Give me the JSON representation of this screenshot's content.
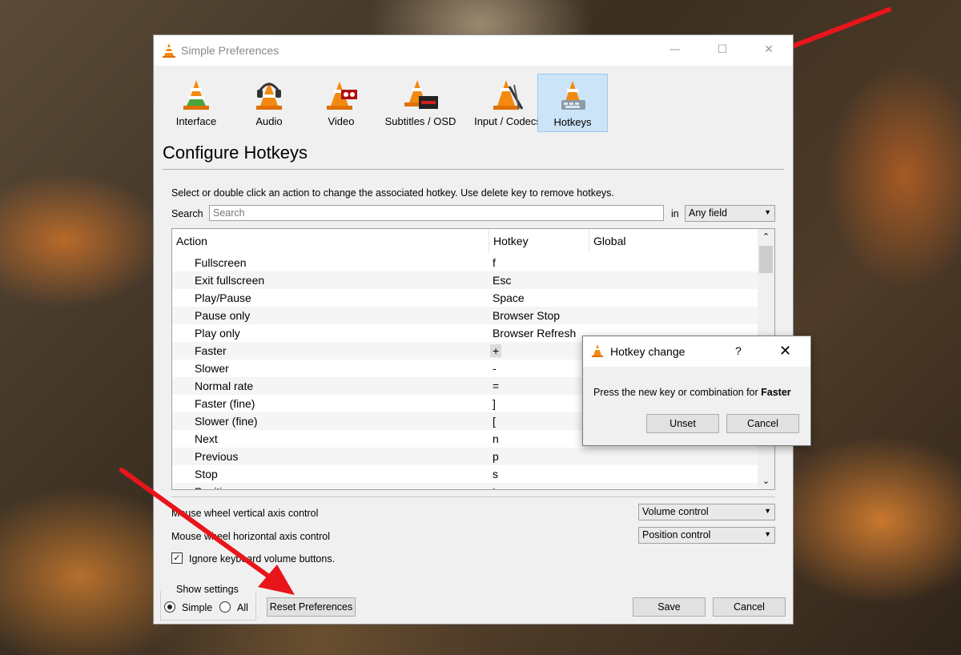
{
  "window": {
    "title": "Simple Preferences",
    "controls": {
      "minimize": "—",
      "maximize": "☐",
      "close": "✕"
    }
  },
  "tabs": [
    {
      "label": "Interface",
      "icon": "interface-cone-icon"
    },
    {
      "label": "Audio",
      "icon": "audio-headphones-cone-icon"
    },
    {
      "label": "Video",
      "icon": "video-cone-icon"
    },
    {
      "label": "Subtitles / OSD",
      "icon": "subtitles-cone-icon"
    },
    {
      "label": "Input / Codecs",
      "icon": "input-codecs-cone-icon"
    },
    {
      "label": "Hotkeys",
      "icon": "hotkeys-cone-icon",
      "active": true
    }
  ],
  "section_title": "Configure Hotkeys",
  "description": "Select or double click an action to change the associated hotkey. Use delete key to remove hotkeys.",
  "search": {
    "label": "Search",
    "placeholder": "Search",
    "in_label": "in",
    "field_value": "Any field"
  },
  "table": {
    "headers": {
      "action": "Action",
      "hotkey": "Hotkey",
      "global": "Global"
    },
    "rows": [
      {
        "action": "Fullscreen",
        "hotkey": "f"
      },
      {
        "action": "Exit fullscreen",
        "hotkey": "Esc"
      },
      {
        "action": "Play/Pause",
        "hotkey": "Space"
      },
      {
        "action": "Pause only",
        "hotkey": "Browser Stop"
      },
      {
        "action": "Play only",
        "hotkey": "Browser Refresh"
      },
      {
        "action": "Faster",
        "hotkey": "+"
      },
      {
        "action": "Slower",
        "hotkey": "-"
      },
      {
        "action": "Normal rate",
        "hotkey": "="
      },
      {
        "action": "Faster (fine)",
        "hotkey": "]"
      },
      {
        "action": "Slower (fine)",
        "hotkey": "["
      },
      {
        "action": "Next",
        "hotkey": "n"
      },
      {
        "action": "Previous",
        "hotkey": "p"
      },
      {
        "action": "Stop",
        "hotkey": "s"
      },
      {
        "action": "Position",
        "hotkey": "t"
      }
    ],
    "scroll_up": "⌃",
    "scroll_down": "⌄"
  },
  "mouse_wheel": {
    "vertical_label": "Mouse wheel vertical axis control",
    "vertical_value": "Volume control",
    "horizontal_label": "Mouse wheel horizontal axis control",
    "horizontal_value": "Position control"
  },
  "ignore_volume": {
    "label": "Ignore keyboard volume buttons.",
    "checked": true,
    "check_mark": "✓"
  },
  "show_settings": {
    "title": "Show settings",
    "simple": "Simple",
    "all": "All",
    "selected": "Simple"
  },
  "buttons": {
    "reset": "Reset Preferences",
    "save": "Save",
    "cancel": "Cancel"
  },
  "dialog": {
    "title": "Hotkey change",
    "help": "?",
    "close": "✕",
    "message_prefix": "Press the new key or combination for ",
    "message_action": "Faster",
    "unset": "Unset",
    "cancel": "Cancel"
  },
  "combo_caret": "▼",
  "colors": {
    "arrow": "#e8151b",
    "active_tab": "#cce4f7",
    "cone_orange": "#f28a0f"
  }
}
